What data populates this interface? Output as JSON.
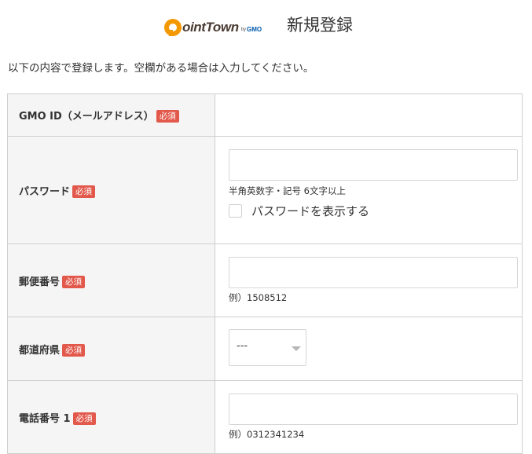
{
  "header": {
    "logo": {
      "wordmark": "ointTown",
      "by": "by",
      "company": "GMO"
    },
    "title": "新規登録"
  },
  "intro": "以下の内容で登録します。空欄がある場合は入力してください。",
  "required_badge": "必須",
  "fields": {
    "gmo_id": {
      "label": "GMO ID（メールアドレス）"
    },
    "password": {
      "label": "パスワード",
      "value": "",
      "hint": "半角英数字・記号 6文字以上",
      "show_password_label": "パスワードを表示する",
      "show_password_checked": false
    },
    "postal_code": {
      "label": "郵便番号",
      "value": "",
      "hint": "例）1508512"
    },
    "prefecture": {
      "label": "都道府県",
      "selected": "---"
    },
    "phone1": {
      "label": "電話番号 1",
      "value": "",
      "hint": "例）0312341234"
    }
  },
  "colors": {
    "required_badge": "#e2594c",
    "label_background": "#f5f5f5",
    "border": "#cfcfcf",
    "brand_orange": "#f39800"
  }
}
